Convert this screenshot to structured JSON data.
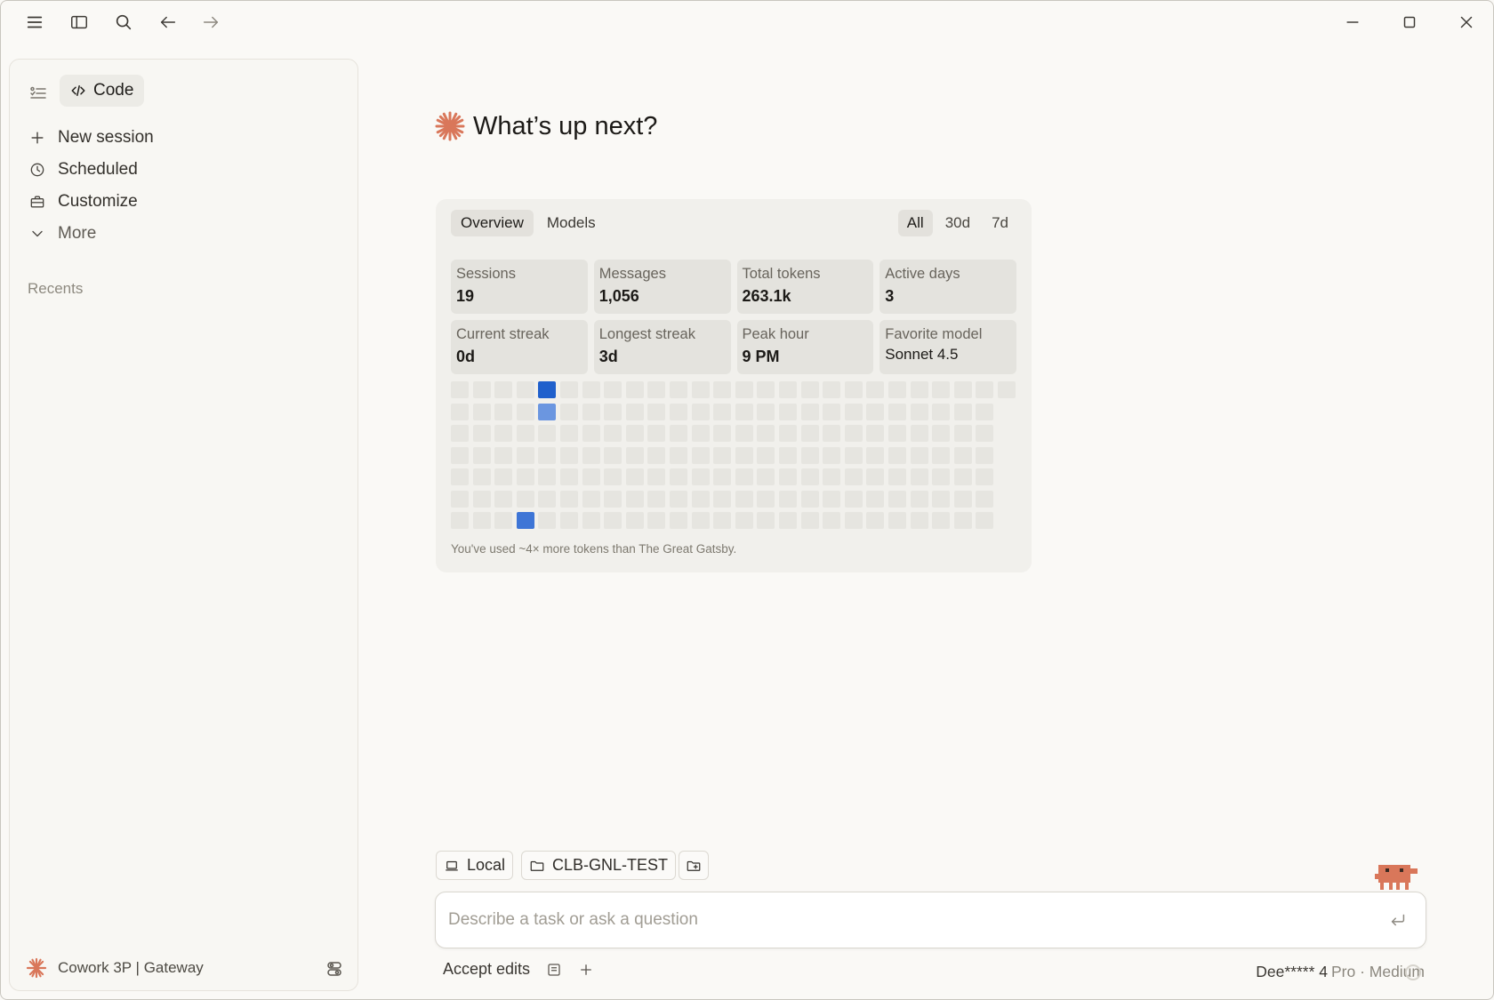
{
  "window": {
    "titlebar_icons": [
      "menu-icon",
      "sidebar-icon",
      "search-icon",
      "back-arrow-icon",
      "forward-arrow-icon",
      "minimize-icon",
      "maximize-icon",
      "close-icon"
    ]
  },
  "sidebar": {
    "mode_label": "Code",
    "items": [
      {
        "label": "New session",
        "icon": "plus-icon"
      },
      {
        "label": "Scheduled",
        "icon": "clock-icon"
      },
      {
        "label": "Customize",
        "icon": "briefcase-icon"
      },
      {
        "label": "More",
        "icon": "chevron-down-icon"
      }
    ],
    "recents_label": "Recents",
    "footer_label": "Cowork 3P | Gateway"
  },
  "main": {
    "heading": "What’s up next?",
    "tabs": [
      "Overview",
      "Models"
    ],
    "ranges": [
      "All",
      "30d",
      "7d"
    ],
    "stats": [
      {
        "label": "Sessions",
        "value": "19"
      },
      {
        "label": "Messages",
        "value": "1,056"
      },
      {
        "label": "Total tokens",
        "value": "263.1k"
      },
      {
        "label": "Active days",
        "value": "3"
      },
      {
        "label": "Current streak",
        "value": "0d"
      },
      {
        "label": "Longest streak",
        "value": "3d"
      },
      {
        "label": "Peak hour",
        "value": "9 PM"
      },
      {
        "label": "Favorite model",
        "value": "Sonnet 4.5"
      }
    ],
    "caption": "You've used ~4× more tokens than The Great Gatsby.",
    "activity": [
      {
        "week": 4,
        "day": 0,
        "level": 3
      },
      {
        "week": 4,
        "day": 1,
        "level": 1
      },
      {
        "week": 3,
        "day": 6,
        "level": 2
      }
    ]
  },
  "composer": {
    "chips": [
      {
        "label": "Local",
        "icon": "laptop-icon"
      },
      {
        "label": "CLB-GNL-TEST",
        "icon": "folder-icon"
      },
      {
        "label": "",
        "icon": "folder-add-icon"
      }
    ],
    "placeholder": "Describe a task or ask a question",
    "permission_label": "Accept edits",
    "model_name": "Dee***** 4",
    "model_suffix": "Pro · Medium"
  },
  "colors": {
    "accent": "#d9775a",
    "heat_level_1": "#6b96e0",
    "heat_level_2": "#3e75d6",
    "heat_level_3": "#2060cc",
    "heat_empty": "#e6e5e0"
  }
}
